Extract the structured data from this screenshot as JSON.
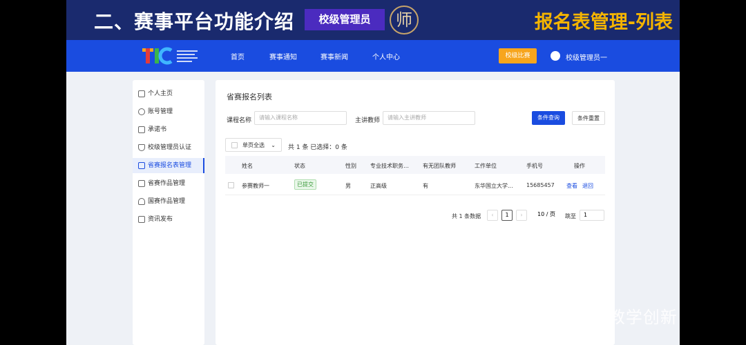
{
  "banner": {
    "title": "二、赛事平台功能介绍",
    "role_tag": "校级管理员",
    "logo_glyph": "师",
    "right_title": "报名表管理-列表"
  },
  "nav": {
    "items": [
      "首页",
      "赛事通知",
      "赛事新闻",
      "个人中心"
    ],
    "button": "校级比赛",
    "user": "校级管理员一"
  },
  "sidebar": {
    "items": [
      {
        "label": "个人主页",
        "icon": "home-icon"
      },
      {
        "label": "账号管理",
        "icon": "gear-icon"
      },
      {
        "label": "承诺书",
        "icon": "document-edit-icon"
      },
      {
        "label": "校级管理员认证",
        "icon": "shield-icon"
      },
      {
        "label": "省赛报名表管理",
        "icon": "form-icon"
      },
      {
        "label": "省赛作品管理",
        "icon": "folder-icon"
      },
      {
        "label": "国赛作品管理",
        "icon": "trophy-icon"
      },
      {
        "label": "资讯发布",
        "icon": "news-icon"
      }
    ],
    "active_index": 4
  },
  "main": {
    "title": "省赛报名列表",
    "filters": {
      "course_label": "课程名称",
      "course_placeholder": "请输入课程名称",
      "teacher_label": "主讲教师",
      "teacher_placeholder": "请输入主讲教师",
      "search_button": "条件查询",
      "reset_button": "条件重置"
    },
    "select_page_label": "单页全选",
    "summary": "共 1 条 已选择：0 条",
    "columns": [
      "姓名",
      "状态",
      "性别",
      "专业技术职务…",
      "有无团队教师",
      "工作单位",
      "手机号",
      "操作"
    ],
    "rows": [
      {
        "name": "参赛教师一",
        "status": "已提交",
        "gender": "男",
        "title": "正高级",
        "team": "有",
        "unit": "东华国立大学...",
        "phone": "15685457",
        "action_view": "查看",
        "action_return": "退回"
      }
    ],
    "pagination": {
      "total": "共 1 条数据",
      "current_page": "1",
      "page_size": "10 / 页",
      "jump_label": "跳至",
      "jump_value": "1"
    }
  },
  "watermark": "公众号 · 教学创新学"
}
